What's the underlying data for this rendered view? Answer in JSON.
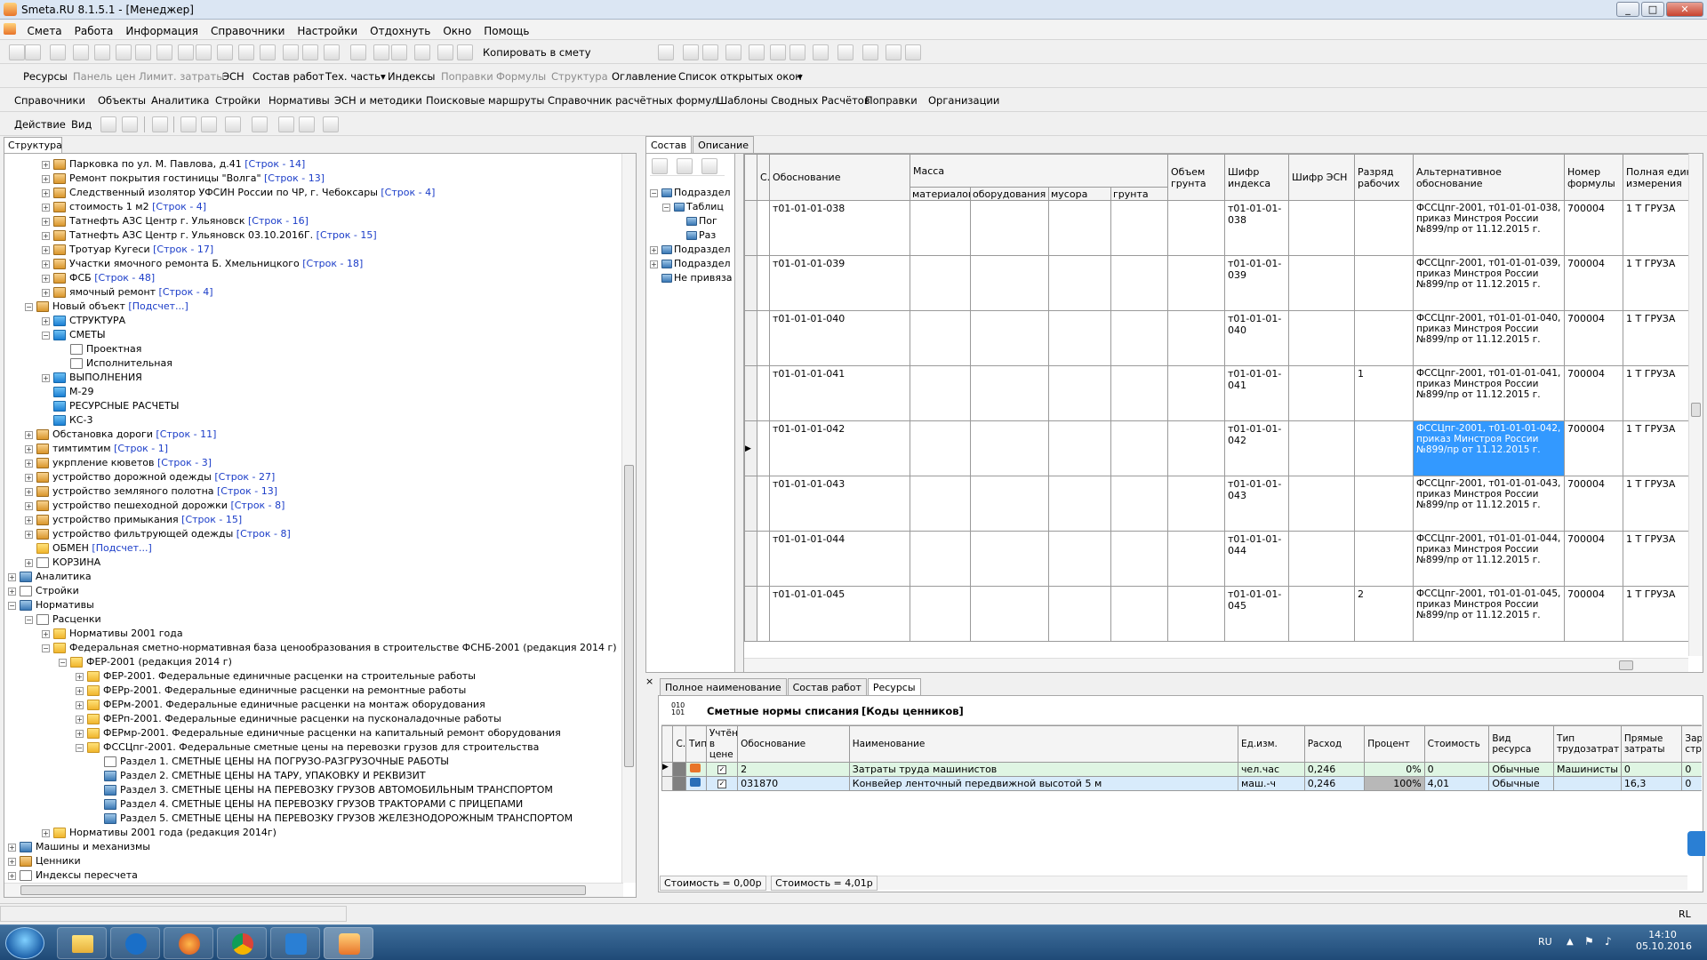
{
  "window": {
    "title": "Smeta.RU  8.1.5.1   - [Менеджер]",
    "btn_min": "_",
    "btn_max": "□",
    "btn_close": "✕"
  },
  "menu": [
    "Смета",
    "Работа",
    "Информация",
    "Справочники",
    "Настройки",
    "Отдохнуть",
    "Окно",
    "Помощь"
  ],
  "toolbar1": {
    "copy_label": "Копировать в смету"
  },
  "toolbar2": {
    "items": [
      {
        "label": "Ресурсы",
        "enabled": true
      },
      {
        "label": "Панель цен",
        "enabled": false
      },
      {
        "label": "Лимит. затраты",
        "enabled": false
      },
      {
        "label": "ЭСН",
        "enabled": true
      },
      {
        "label": "Состав работ",
        "enabled": true
      },
      {
        "label": "Тех. часть",
        "enabled": true
      },
      {
        "label": "Индексы",
        "enabled": true
      },
      {
        "label": "Поправки",
        "enabled": false
      },
      {
        "label": "Формулы",
        "enabled": false
      },
      {
        "label": "Структура",
        "enabled": false
      },
      {
        "label": "Оглавление",
        "enabled": true
      },
      {
        "label": "Список открытых окон",
        "enabled": true
      }
    ]
  },
  "toolbar3": [
    "Справочники",
    "Объекты",
    "Аналитика",
    "Стройки",
    "Нормативы",
    "ЭСН и методики",
    "Поисковые маршруты",
    "Справочник расчётных формул",
    "Шаблоны Сводных Расчётов",
    "Поправки",
    "Организации"
  ],
  "toolbar4": {
    "action": "Действие",
    "view": "Вид"
  },
  "left_panel": {
    "tab": "Структура",
    "tree": [
      {
        "indent": 2,
        "pm": "+",
        "icon": "house",
        "text": "Парковка по ул. М. Павлова, д.41",
        "link": "[Строк - 14]"
      },
      {
        "indent": 2,
        "pm": "+",
        "icon": "house",
        "text": "Ремонт покрытия гостиницы \"Волга\"",
        "link": "[Строк - 13]"
      },
      {
        "indent": 2,
        "pm": "+",
        "icon": "house",
        "text": "Следственный изолятор УФСИН России по ЧР, г. Чебоксары",
        "link": "[Строк - 4]"
      },
      {
        "indent": 2,
        "pm": "+",
        "icon": "house",
        "text": "стоимость 1 м2",
        "link": "[Строк - 4]"
      },
      {
        "indent": 2,
        "pm": "+",
        "icon": "house",
        "text": "Татнефть АЗС Центр г. Ульяновск",
        "link": "[Строк - 16]"
      },
      {
        "indent": 2,
        "pm": "+",
        "icon": "house",
        "text": "Татнефть АЗС Центр г. Ульяновск 03.10.2016Г.",
        "link": "[Строк - 15]"
      },
      {
        "indent": 2,
        "pm": "+",
        "icon": "house",
        "text": "Тротуар Кугеси",
        "link": "[Строк - 17]"
      },
      {
        "indent": 2,
        "pm": "+",
        "icon": "house",
        "text": "Участки ямочного ремонта Б. Хмельницкого",
        "link": "[Строк - 18]"
      },
      {
        "indent": 2,
        "pm": "+",
        "icon": "house",
        "text": "ФСБ",
        "link": "[Строк - 48]"
      },
      {
        "indent": 2,
        "pm": "+",
        "icon": "house",
        "text": "ямочный ремонт",
        "link": "[Строк - 4]"
      },
      {
        "indent": 1,
        "pm": "−",
        "icon": "house",
        "text": "Новый объект",
        "link": "[Подсчет...]"
      },
      {
        "indent": 2,
        "pm": "+",
        "icon": "blue",
        "text": "СТРУКТУРА",
        "link": ""
      },
      {
        "indent": 2,
        "pm": "−",
        "icon": "blue",
        "text": "СМЕТЫ",
        "link": ""
      },
      {
        "indent": 3,
        "pm": "",
        "icon": "doc",
        "text": "Проектная",
        "link": ""
      },
      {
        "indent": 3,
        "pm": "",
        "icon": "doc",
        "text": "Исполнительная",
        "link": ""
      },
      {
        "indent": 2,
        "pm": "+",
        "icon": "blue",
        "text": "ВЫПОЛНЕНИЯ",
        "link": ""
      },
      {
        "indent": 2,
        "pm": "",
        "icon": "blue",
        "text": "М-29",
        "link": ""
      },
      {
        "indent": 2,
        "pm": "",
        "icon": "blue",
        "text": "РЕСУРСНЫЕ РАСЧЕТЫ",
        "link": ""
      },
      {
        "indent": 2,
        "pm": "",
        "icon": "blue",
        "text": "КС-3",
        "link": ""
      },
      {
        "indent": 1,
        "pm": "+",
        "icon": "house",
        "text": "Обстановка дороги",
        "link": "[Строк - 11]"
      },
      {
        "indent": 1,
        "pm": "+",
        "icon": "house",
        "text": "тимтимтим",
        "link": "[Строк - 1]"
      },
      {
        "indent": 1,
        "pm": "+",
        "icon": "house",
        "text": "укрпление кюветов",
        "link": "[Строк - 3]"
      },
      {
        "indent": 1,
        "pm": "+",
        "icon": "house",
        "text": "устройство дорожной одежды",
        "link": "[Строк - 27]"
      },
      {
        "indent": 1,
        "pm": "+",
        "icon": "house",
        "text": "устройство земляного полотна",
        "link": "[Строк - 13]"
      },
      {
        "indent": 1,
        "pm": "+",
        "icon": "house",
        "text": "устройство пешеходной дорожки",
        "link": "[Строк - 8]"
      },
      {
        "indent": 1,
        "pm": "+",
        "icon": "house",
        "text": "устройство примыкания",
        "link": "[Строк - 15]"
      },
      {
        "indent": 1,
        "pm": "+",
        "icon": "house",
        "text": "устройство фильтрующей одежды",
        "link": "[Строк - 8]"
      },
      {
        "indent": 1,
        "pm": "",
        "icon": "folder",
        "text": "ОБМЕН",
        "link": "[Подсчет...]"
      },
      {
        "indent": 1,
        "pm": "+",
        "icon": "doc",
        "text": "КОРЗИНА",
        "link": ""
      },
      {
        "indent": 0,
        "pm": "+",
        "icon": "book",
        "text": "Аналитика",
        "link": ""
      },
      {
        "indent": 0,
        "pm": "+",
        "icon": "doc",
        "text": "Стройки",
        "link": ""
      },
      {
        "indent": 0,
        "pm": "−",
        "icon": "book",
        "text": "Нормативы",
        "link": ""
      },
      {
        "indent": 1,
        "pm": "−",
        "icon": "doc",
        "text": "Расценки",
        "link": ""
      },
      {
        "indent": 2,
        "pm": "+",
        "icon": "folder",
        "text": "Нормативы 2001 года",
        "link": ""
      },
      {
        "indent": 2,
        "pm": "−",
        "icon": "folder",
        "text": "Федеральная сметно-нормативная база ценообразования в строительстве ФСНБ-2001 (редакция 2014 г)",
        "link": ""
      },
      {
        "indent": 3,
        "pm": "−",
        "icon": "folder",
        "text": "ФЕР-2001 (редакция 2014 г)",
        "link": ""
      },
      {
        "indent": 4,
        "pm": "+",
        "icon": "folder",
        "text": "ФЕР-2001. Федеральные единичные расценки на строительные работы",
        "link": ""
      },
      {
        "indent": 4,
        "pm": "+",
        "icon": "folder",
        "text": "ФЕРр-2001. Федеральные единичные расценки на ремонтные работы",
        "link": ""
      },
      {
        "indent": 4,
        "pm": "+",
        "icon": "folder",
        "text": "ФЕРм-2001. Федеральные единичные расценки на монтаж оборудования",
        "link": ""
      },
      {
        "indent": 4,
        "pm": "+",
        "icon": "folder",
        "text": "ФЕРп-2001. Федеральные единичные расценки на пусконаладочные работы",
        "link": ""
      },
      {
        "indent": 4,
        "pm": "+",
        "icon": "folder",
        "text": "ФЕРмр-2001. Федеральные единичные расценки на капитальный ремонт оборудования",
        "link": ""
      },
      {
        "indent": 4,
        "pm": "−",
        "icon": "folder",
        "text": "ФССЦпг-2001. Федеральные сметные цены на перевозки грузов для строительства",
        "link": ""
      },
      {
        "indent": 5,
        "pm": "",
        "icon": "doc",
        "text": "Раздел 1. СМЕТНЫЕ ЦЕНЫ НА ПОГРУЗО-РАЗГРУЗОЧНЫЕ РАБОТЫ",
        "link": ""
      },
      {
        "indent": 5,
        "pm": "",
        "icon": "book",
        "text": "Раздел 2. СМЕТНЫЕ ЦЕНЫ НА ТАРУ, УПАКОВКУ И РЕКВИЗИТ",
        "link": ""
      },
      {
        "indent": 5,
        "pm": "",
        "icon": "book",
        "text": "Раздел 3. СМЕТНЫЕ ЦЕНЫ НА ПЕРЕВОЗКУ ГРУЗОВ АВТОМОБИЛЬНЫМ ТРАНСПОРТОМ",
        "link": ""
      },
      {
        "indent": 5,
        "pm": "",
        "icon": "book",
        "text": "Раздел 4. СМЕТНЫЕ ЦЕНЫ НА ПЕРЕВОЗКУ ГРУЗОВ ТРАКТОРАМИ С ПРИЦЕПАМИ",
        "link": ""
      },
      {
        "indent": 5,
        "pm": "",
        "icon": "book",
        "text": "Раздел 5. СМЕТНЫЕ ЦЕНЫ НА ПЕРЕВОЗКУ ГРУЗОВ ЖЕЛЕЗНОДОРОЖНЫМ ТРАНСПОРТОМ",
        "link": ""
      },
      {
        "indent": 2,
        "pm": "+",
        "icon": "folder",
        "text": "Нормативы 2001 года (редакция 2014г)",
        "link": ""
      },
      {
        "indent": 0,
        "pm": "+",
        "icon": "book",
        "text": "Машины и механизмы",
        "link": ""
      },
      {
        "indent": 0,
        "pm": "+",
        "icon": "house",
        "text": "Ценники",
        "link": ""
      },
      {
        "indent": 0,
        "pm": "+",
        "icon": "doc",
        "text": "Индексы пересчета",
        "link": ""
      }
    ]
  },
  "right_tabs": [
    "Состав",
    "Описание"
  ],
  "mini_tree": [
    {
      "indent": 0,
      "pm": "−",
      "text": "Подраздел"
    },
    {
      "indent": 1,
      "pm": "−",
      "text": "Таблиц"
    },
    {
      "indent": 2,
      "pm": "",
      "text": "Пог"
    },
    {
      "indent": 2,
      "pm": "",
      "text": "Раз"
    },
    {
      "indent": 0,
      "pm": "+",
      "text": "Подраздел"
    },
    {
      "indent": 0,
      "pm": "+",
      "text": "Подраздел"
    },
    {
      "indent": 0,
      "pm": "",
      "text": "Не привяза"
    }
  ],
  "main_grid": {
    "headers": {
      "c": "С.",
      "obosn": "Обоснование",
      "massa": "Масса",
      "m_mat": "материалов",
      "m_obor": "оборудования",
      "m_mus": "мусора",
      "m_gr": "грунта",
      "volume": "Объем грунта",
      "index": "Шифр индекса",
      "esn": "Шифр ЭСН",
      "rank": "Разряд рабочих",
      "alt": "Альтернативное обоснование",
      "formula": "Номер формулы",
      "unit": "Полная едини измерения"
    },
    "rows": [
      {
        "code": "т01-01-01-038",
        "index": "т01-01-01-038",
        "rank": "",
        "alt": "ФССЦпг-2001, т01-01-01-038, приказ Минстроя России №899/пр от 11.12.2015 г.",
        "formula": "700004",
        "unit": "1 Т ГРУЗА"
      },
      {
        "code": "т01-01-01-039",
        "index": "т01-01-01-039",
        "rank": "",
        "alt": "ФССЦпг-2001, т01-01-01-039, приказ Минстроя России №899/пр от 11.12.2015 г.",
        "formula": "700004",
        "unit": "1 Т ГРУЗА"
      },
      {
        "code": "т01-01-01-040",
        "index": "т01-01-01-040",
        "rank": "",
        "alt": "ФССЦпг-2001, т01-01-01-040, приказ Минстроя России №899/пр от 11.12.2015 г.",
        "formula": "700004",
        "unit": "1 Т ГРУЗА"
      },
      {
        "code": "т01-01-01-041",
        "index": "т01-01-01-041",
        "rank": "1",
        "alt": "ФССЦпг-2001, т01-01-01-041, приказ Минстроя России №899/пр от 11.12.2015 г.",
        "formula": "700004",
        "unit": "1 Т ГРУЗА"
      },
      {
        "code": "т01-01-01-042",
        "index": "т01-01-01-042",
        "rank": "",
        "alt": "ФССЦпг-2001, т01-01-01-042, приказ Минстроя России №899/пр от 11.12.2015 г.",
        "formula": "700004",
        "unit": "1 Т ГРУЗА"
      },
      {
        "code": "т01-01-01-043",
        "index": "т01-01-01-043",
        "rank": "",
        "alt": "ФССЦпг-2001, т01-01-01-043, приказ Минстроя России №899/пр от 11.12.2015 г.",
        "formula": "700004",
        "unit": "1 Т ГРУЗА"
      },
      {
        "code": "т01-01-01-044",
        "index": "т01-01-01-044",
        "rank": "",
        "alt": "ФССЦпг-2001, т01-01-01-044, приказ Минстроя России №899/пр от 11.12.2015 г.",
        "formula": "700004",
        "unit": "1 Т ГРУЗА"
      },
      {
        "code": "т01-01-01-045",
        "index": "т01-01-01-045",
        "rank": "2",
        "alt": "ФССЦпг-2001, т01-01-01-045, приказ Минстроя России №899/пр от 11.12.2015 г.",
        "formula": "700004",
        "unit": "1 Т ГРУЗА"
      }
    ],
    "selected_row": 4
  },
  "bottom_tabs": [
    "Полное наименование",
    "Состав работ",
    "Ресурсы"
  ],
  "bottom": {
    "title": "Сметные нормы списания",
    "subtitle": "[Коды ценников]",
    "headers": [
      "С.",
      "Тип",
      "Учтён в цене",
      "Обоснование",
      "Наименование",
      "Ед.изм.",
      "Расход",
      "Процент",
      "Стоимость",
      "Вид ресурса",
      "Тип трудозатрат",
      "Прямые затраты",
      "Зарпла строит"
    ],
    "rows": [
      {
        "obosn": "2",
        "name": "Затраты труда машинистов",
        "unit": "чел.час",
        "rashod": "0,246",
        "pct": "0%",
        "cost": "0",
        "kind": "Обычные",
        "labor": "Машинисты",
        "direct": "0",
        "wage": "0"
      },
      {
        "obosn": "031870",
        "name": "Конвейер ленточный передвижной высотой 5 м",
        "unit": "маш.-ч",
        "rashod": "0,246",
        "pct": "100%",
        "cost": "4,01",
        "kind": "Обычные",
        "labor": "",
        "direct": "16,3",
        "wage": "0"
      }
    ],
    "status1": "Стоимость = 0,00р",
    "status2": "Стоимость = 4,01р"
  },
  "statusbar": {
    "lang_short": "RL"
  },
  "taskbar": {
    "lang": "RU",
    "time": "14:10",
    "date": "05.10.2016"
  }
}
